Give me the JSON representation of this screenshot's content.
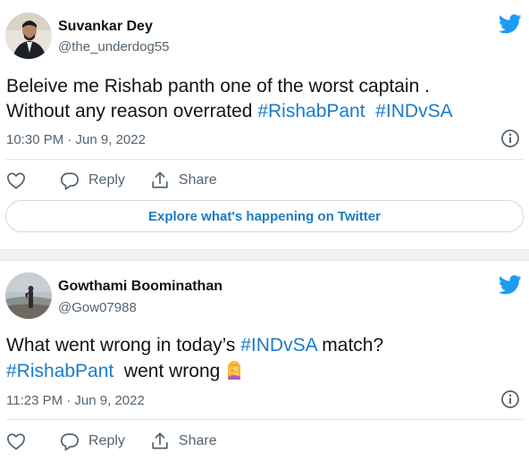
{
  "tweets": [
    {
      "name": "Suvankar Dey",
      "handle": "@the_underdog55",
      "text_line1": "Beleive me Rishab panth one of the worst captain .",
      "text_line2_prefix": "Without any reason overrated ",
      "hashtag_a": "#RishabPant",
      "hashtag_b": "#INDvSA",
      "timestamp": "10:30 PM · Jun 9, 2022",
      "reply_label": "Reply",
      "share_label": "Share",
      "explore_label": "Explore what's happening on Twitter"
    },
    {
      "name": "Gowthami Boominathan",
      "handle": "@Gow07988",
      "text_line1_prefix": "What went wrong in today’s ",
      "hashtag_a": "#INDvSA",
      "text_line1_suffix": " match?",
      "hashtag_b": "#RishabPant",
      "text_line2_suffix": "  went wrong",
      "emoji": "woman-facepalming-emoji",
      "timestamp": "11:23 PM · Jun 9, 2022",
      "reply_label": "Reply",
      "share_label": "Share"
    }
  ],
  "colors": {
    "accent": "#1d9bf0",
    "hashtag": "#1b7bc8",
    "muted": "#536471",
    "divider": "#dfe5ea"
  },
  "icons": [
    "twitter-bird-icon",
    "info-icon",
    "heart-icon",
    "reply-bubble-icon",
    "share-icon"
  ]
}
